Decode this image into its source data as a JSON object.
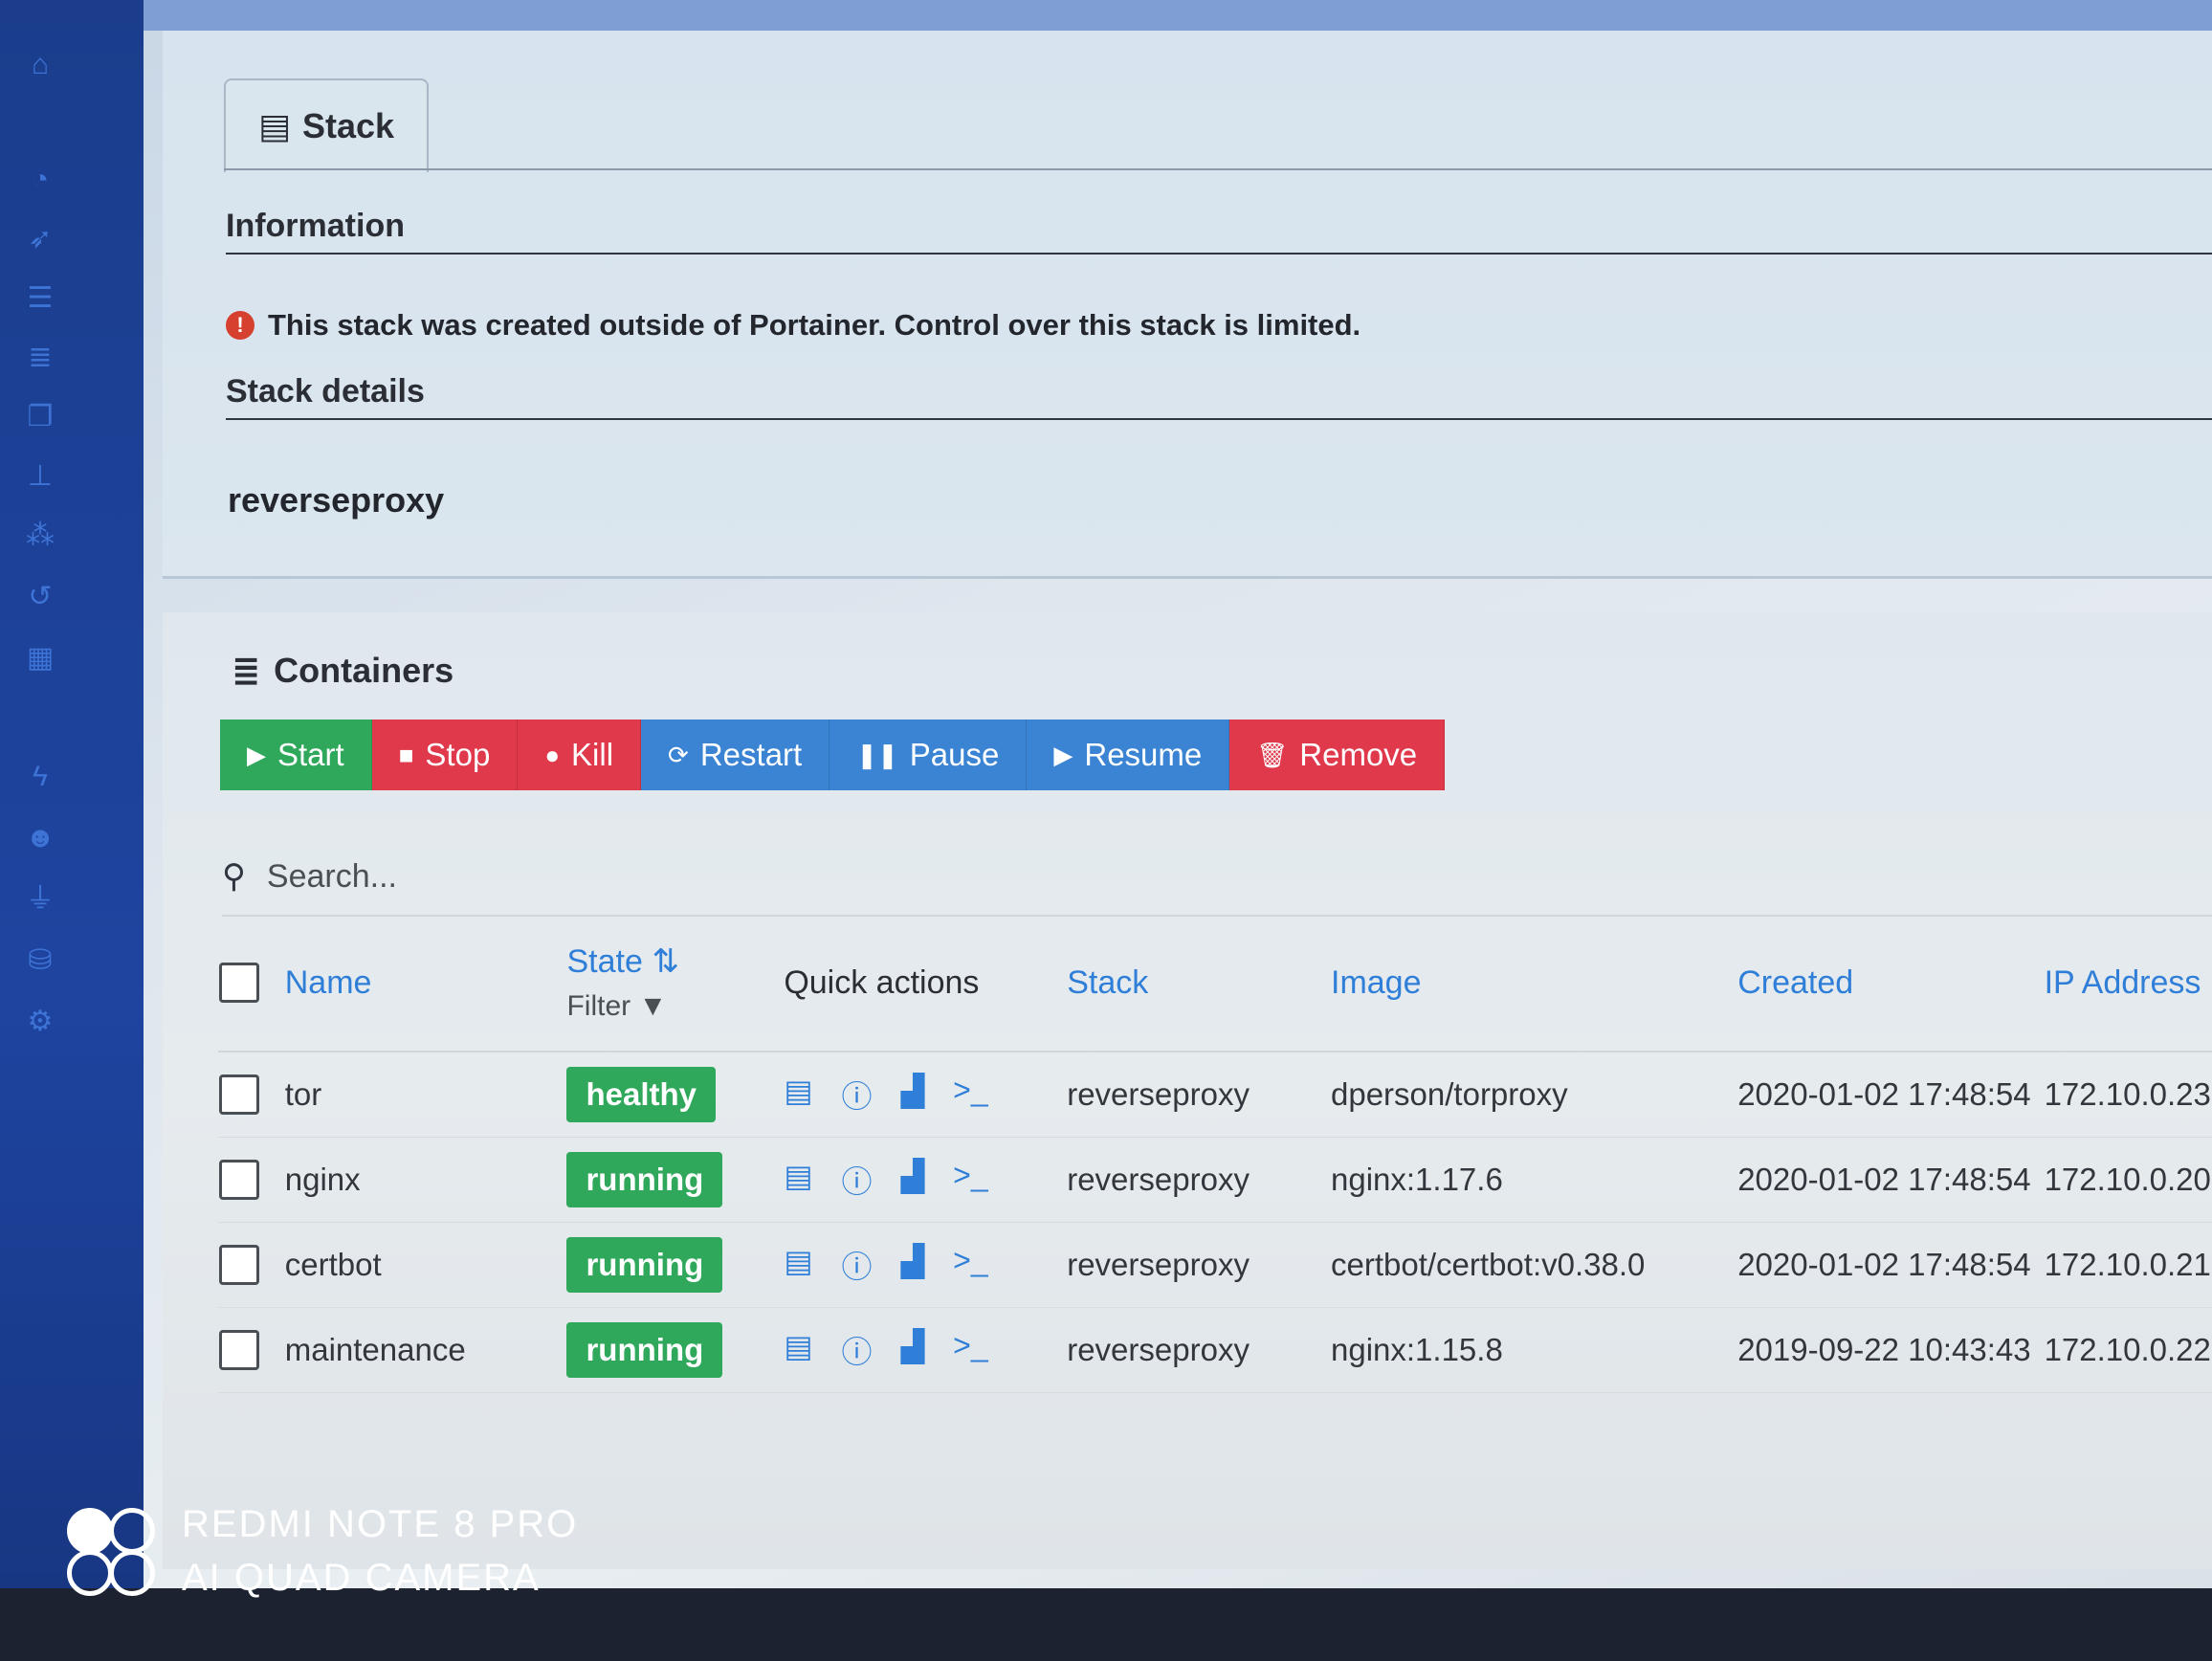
{
  "sidebar": {
    "icons": [
      "home-icon",
      "tachometer-icon",
      "rocket-icon",
      "list-icon",
      "server-icon",
      "clone-icon",
      "sitemap-icon",
      "cubes-icon",
      "history-icon",
      "grid-icon",
      "bolt-icon",
      "users-icon",
      "plug-icon",
      "database-icon",
      "cogs-icon"
    ]
  },
  "tab": {
    "label": "Stack",
    "icon": "th-list-icon"
  },
  "information": {
    "title": "Information",
    "message": "This stack was created outside of Portainer. Control over this stack is limited."
  },
  "stack_details": {
    "title": "Stack details",
    "name": "reverseproxy"
  },
  "containers": {
    "title": "Containers",
    "buttons": [
      {
        "label": "Start",
        "color": "green",
        "icon": "play-icon"
      },
      {
        "label": "Stop",
        "color": "red",
        "icon": "stop-icon"
      },
      {
        "label": "Kill",
        "color": "red",
        "icon": "bomb-icon"
      },
      {
        "label": "Restart",
        "color": "blue",
        "icon": "sync-icon"
      },
      {
        "label": "Pause",
        "color": "blue",
        "icon": "pause-icon"
      },
      {
        "label": "Resume",
        "color": "blue",
        "icon": "play-icon"
      },
      {
        "label": "Remove",
        "color": "red",
        "icon": "trash-icon"
      }
    ],
    "search_placeholder": "Search...",
    "columns": {
      "name": "Name",
      "state": "State",
      "filter": "Filter",
      "quick_actions": "Quick actions",
      "stack": "Stack",
      "image": "Image",
      "created": "Created",
      "ip": "IP Address"
    },
    "rows": [
      {
        "name": "tor",
        "state": "healthy",
        "stack": "reverseproxy",
        "image": "dperson/torproxy",
        "created": "2020-01-02 17:48:54",
        "ip": "172.10.0.23"
      },
      {
        "name": "nginx",
        "state": "running",
        "stack": "reverseproxy",
        "image": "nginx:1.17.6",
        "created": "2020-01-02 17:48:54",
        "ip": "172.10.0.20"
      },
      {
        "name": "certbot",
        "state": "running",
        "stack": "reverseproxy",
        "image": "certbot/certbot:v0.38.0",
        "created": "2020-01-02 17:48:54",
        "ip": "172.10.0.21"
      },
      {
        "name": "maintenance",
        "state": "running",
        "stack": "reverseproxy",
        "image": "nginx:1.15.8",
        "created": "2019-09-22 10:43:43",
        "ip": "172.10.0.22"
      }
    ]
  },
  "watermark": {
    "line1": "REDMI NOTE 8 PRO",
    "line2": "AI QUAD CAMERA"
  },
  "colors": {
    "green": "#2fa85b",
    "red": "#e0394c",
    "blue": "#3b83d3",
    "link": "#2f7ed8"
  }
}
